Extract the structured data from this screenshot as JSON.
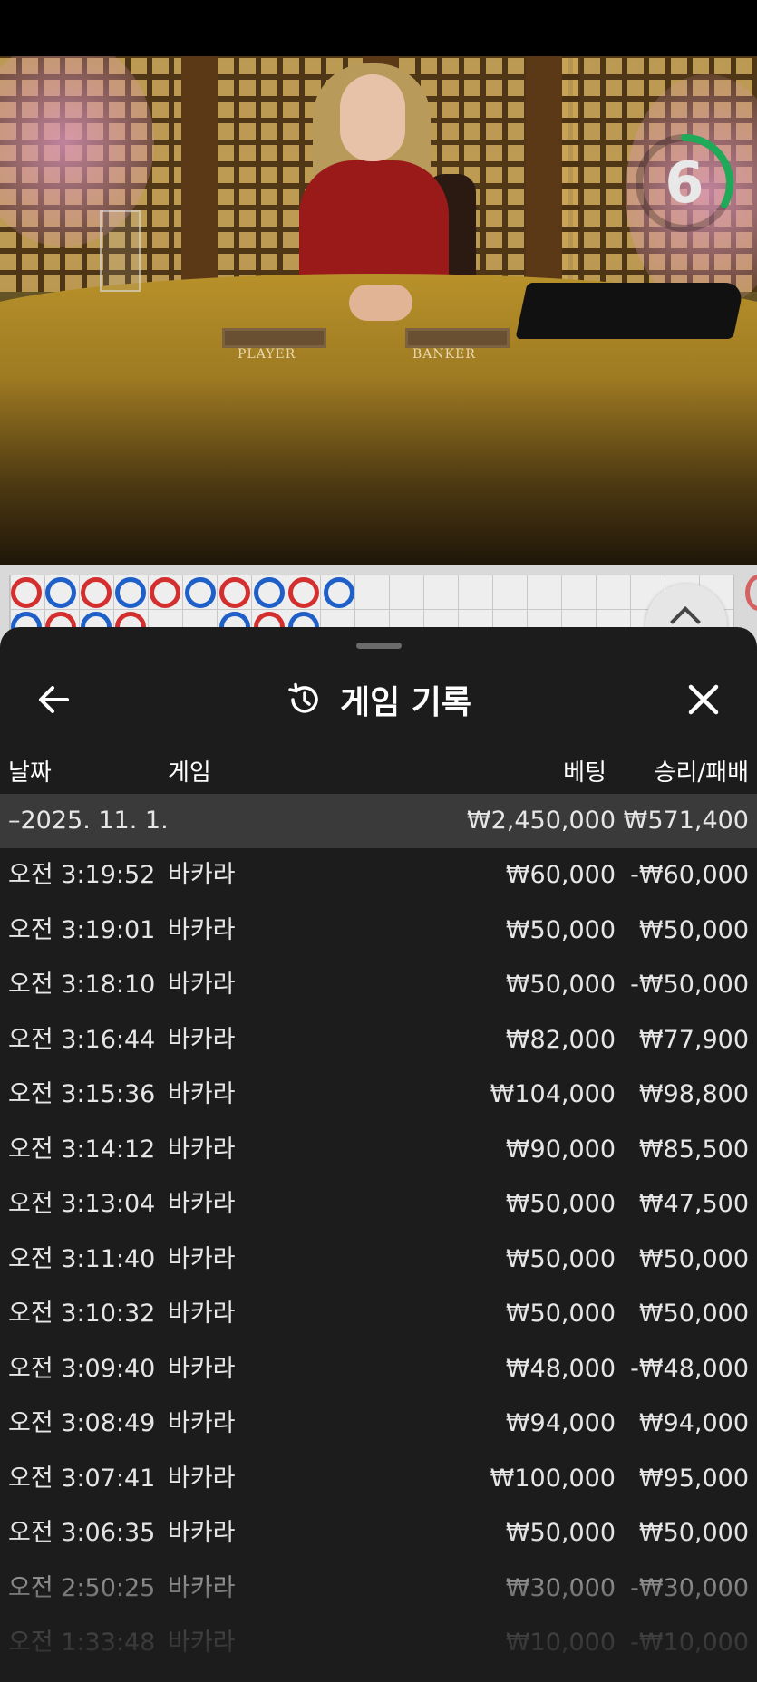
{
  "video": {
    "countdown": "6",
    "table_labels": {
      "player": "PLAYER",
      "banker": "BANKER"
    },
    "countdown_color": "#1faa59"
  },
  "roadmap": {
    "row1": [
      "banker",
      "player",
      "banker",
      "player",
      "banker",
      "player",
      "banker",
      "player",
      "banker",
      "player"
    ],
    "row2": [
      "player",
      "banker",
      "player",
      "banker",
      "",
      "",
      "player",
      "banker",
      "player"
    ],
    "colors": {
      "banker": "#d32f2f",
      "player": "#1e5fc8"
    }
  },
  "sheet": {
    "title": "게임 기록",
    "icons": {
      "back": "arrow-left-icon",
      "history": "history-icon",
      "close": "close-icon"
    },
    "columns": {
      "date": "날짜",
      "game": "게임",
      "bet": "베팅",
      "result": "승리/패배"
    },
    "date_group": {
      "label": "–2025. 11. 1.",
      "total_bet": "₩2,450,000",
      "total_result": "₩571,400"
    },
    "rows": [
      {
        "time": "오전 3:19:52",
        "game": "바카라",
        "bet": "₩60,000",
        "result": "-₩60,000"
      },
      {
        "time": "오전 3:19:01",
        "game": "바카라",
        "bet": "₩50,000",
        "result": "₩50,000"
      },
      {
        "time": "오전 3:18:10",
        "game": "바카라",
        "bet": "₩50,000",
        "result": "-₩50,000"
      },
      {
        "time": "오전 3:16:44",
        "game": "바카라",
        "bet": "₩82,000",
        "result": "₩77,900"
      },
      {
        "time": "오전 3:15:36",
        "game": "바카라",
        "bet": "₩104,000",
        "result": "₩98,800"
      },
      {
        "time": "오전 3:14:12",
        "game": "바카라",
        "bet": "₩90,000",
        "result": "₩85,500"
      },
      {
        "time": "오전 3:13:04",
        "game": "바카라",
        "bet": "₩50,000",
        "result": "₩47,500"
      },
      {
        "time": "오전 3:11:40",
        "game": "바카라",
        "bet": "₩50,000",
        "result": "₩50,000"
      },
      {
        "time": "오전 3:10:32",
        "game": "바카라",
        "bet": "₩50,000",
        "result": "₩50,000"
      },
      {
        "time": "오전 3:09:40",
        "game": "바카라",
        "bet": "₩48,000",
        "result": "-₩48,000"
      },
      {
        "time": "오전 3:08:49",
        "game": "바카라",
        "bet": "₩94,000",
        "result": "₩94,000"
      },
      {
        "time": "오전 3:07:41",
        "game": "바카라",
        "bet": "₩100,000",
        "result": "₩95,000"
      },
      {
        "time": "오전 3:06:35",
        "game": "바카라",
        "bet": "₩50,000",
        "result": "₩50,000"
      },
      {
        "time": "오전 2:50:25",
        "game": "바카라",
        "bet": "₩30,000",
        "result": "-₩30,000"
      },
      {
        "time": "오전 1:33:48",
        "game": "바카라",
        "bet": "₩10,000",
        "result": "-₩10,000"
      }
    ]
  }
}
